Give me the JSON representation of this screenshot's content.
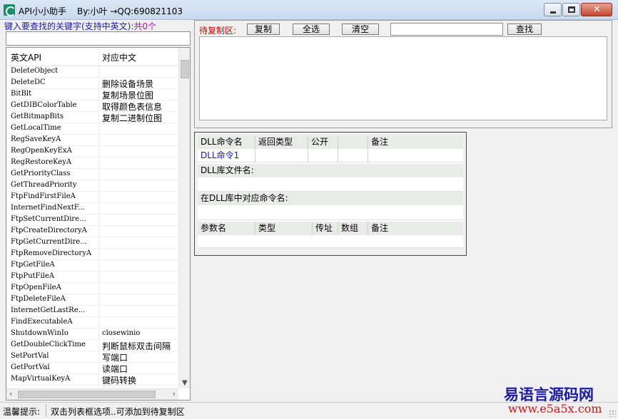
{
  "window": {
    "title": "API小小助手",
    "author": "By:小叶 →QQ:690821103"
  },
  "search": {
    "hint": "键入要查找的关键字(支持中英文):",
    "count": "共0个",
    "value": ""
  },
  "api_list": {
    "columns": [
      "英文API",
      "对应中文"
    ],
    "rows": [
      [
        "DeleteObject",
        ""
      ],
      [
        "DeleteDC",
        "删除设备场景"
      ],
      [
        "BitBlt",
        "复制场景位图"
      ],
      [
        "GetDIBColorTable",
        "取得颜色表信息"
      ],
      [
        "GetBitmapBits",
        "复制二进制位图"
      ],
      [
        "GetLocalTime",
        ""
      ],
      [
        "RegSaveKeyA",
        ""
      ],
      [
        "RegOpenKeyExA",
        ""
      ],
      [
        "RegRestoreKeyA",
        ""
      ],
      [
        "GetPriorityClass",
        ""
      ],
      [
        "GetThreadPriority",
        ""
      ],
      [
        "FtpFindFirstFileA",
        ""
      ],
      [
        "InternetFindNextF...",
        ""
      ],
      [
        "FtpSetCurrentDire...",
        ""
      ],
      [
        "FtpCreateDirectoryA",
        ""
      ],
      [
        "FtpGetCurrentDire...",
        ""
      ],
      [
        "FtpRemoveDirectoryA",
        ""
      ],
      [
        "FtpGetFileA",
        ""
      ],
      [
        "FtpPutFileA",
        ""
      ],
      [
        "FtpOpenFileA",
        ""
      ],
      [
        "FtpDeleteFileA",
        ""
      ],
      [
        "InternetGetLastRe...",
        ""
      ],
      [
        "FindExecutableA",
        ""
      ],
      [
        "ShutdownWinIo",
        "closewinio"
      ],
      [
        "GetDoubleClickTime",
        "判断鼠标双击间隔"
      ],
      [
        "SetPortVal",
        "写端口"
      ],
      [
        "GetPortVal",
        "读端口"
      ],
      [
        "MapVirtualKeyA",
        "键码转换"
      ]
    ]
  },
  "clipboard": {
    "label": "待复制区:",
    "copy_label": "复制",
    "select_all_label": "全选",
    "clear_label": "清空",
    "find_label": "查找",
    "find_value": "",
    "content": ""
  },
  "dll": {
    "headers": [
      "DLL命令名",
      "返回类型",
      "公开",
      "",
      "备注"
    ],
    "command": [
      "DLL命令1",
      "",
      "",
      "",
      ""
    ],
    "lib_label": "DLL库文件名:",
    "lib_value": "",
    "entry_label": "在DLL库中对应命令名:",
    "entry_value": "",
    "param_headers": [
      "参数名",
      "类型",
      "传址",
      "数组",
      "备注"
    ]
  },
  "status": {
    "label": "温馨提示:",
    "text": "双击列表框选项..可添加到待复制区"
  },
  "watermark": {
    "line1": "易语言源码网",
    "line2": "www.e5a5x.com"
  }
}
